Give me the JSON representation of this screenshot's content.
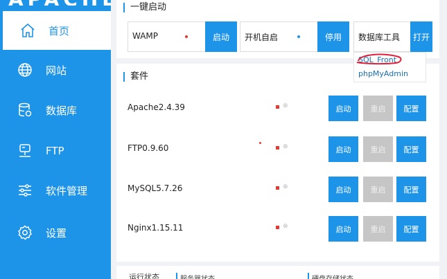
{
  "brand": {
    "text": "APACHE"
  },
  "sidebar": {
    "items": [
      {
        "label": "首页",
        "icon": "home-icon",
        "active": true
      },
      {
        "label": "网站",
        "icon": "globe-icon",
        "active": false
      },
      {
        "label": "数据库",
        "icon": "database-icon",
        "active": false
      },
      {
        "label": "FTP",
        "icon": "ftp-server-icon",
        "active": false
      },
      {
        "label": "软件管理",
        "icon": "sliders-icon",
        "active": false
      },
      {
        "label": "设置",
        "icon": "settings-icon",
        "active": false
      }
    ]
  },
  "quick_start": {
    "title": "一键启动",
    "groups": [
      {
        "label": "WAMP",
        "dot_color": "#e53935",
        "button": "启动"
      },
      {
        "label": "开机自启",
        "dot_color": "#1e94e8",
        "button": "停用"
      },
      {
        "label": "数据库工具",
        "button": "打开"
      }
    ],
    "dropdown": [
      "SQL_Front",
      "phpMyAdmin"
    ]
  },
  "suite": {
    "title": "套件",
    "services": [
      {
        "name": "Apache2.4.39",
        "start": "启动",
        "restart": "重启",
        "config": "配置"
      },
      {
        "name": "FTP0.9.60",
        "start": "启动",
        "restart": "重启",
        "config": "配置"
      },
      {
        "name": "MySQL5.7.26",
        "start": "启动",
        "restart": "重启",
        "config": "配置"
      },
      {
        "name": "Nginx1.15.11",
        "start": "启动",
        "restart": "重启",
        "config": "配置"
      }
    ]
  },
  "status_bar": {
    "title": "运行状态",
    "service_status": "服务器状态",
    "disk_status": "硬盘存储状态"
  },
  "colors": {
    "accent": "#1e94e8",
    "stop": "#e53935",
    "disabled": "#c6c6c6"
  }
}
